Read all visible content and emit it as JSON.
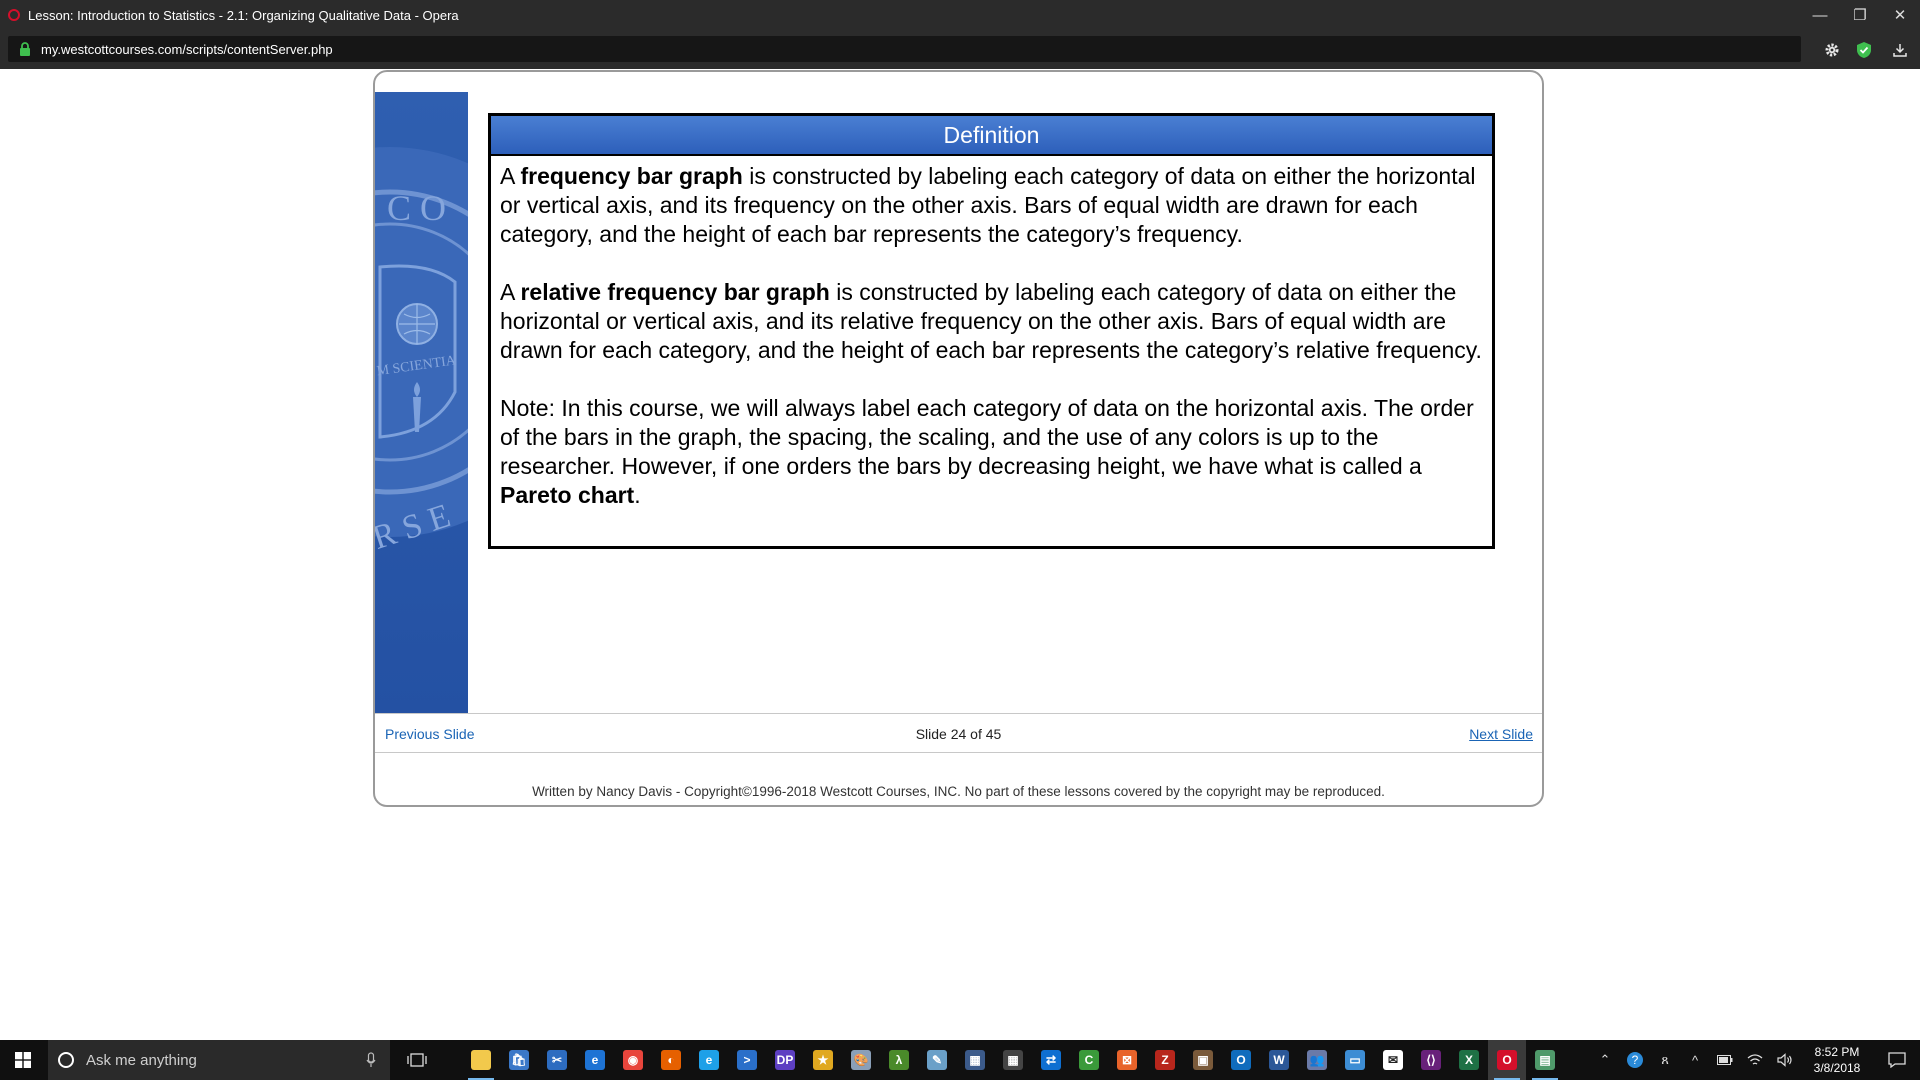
{
  "window": {
    "title": "Lesson: Introduction to Statistics - 2.1: Organizing Qualitative Data - Opera",
    "url": "my.westcottcourses.com/scripts/contentServer.php",
    "minimize_glyph": "—",
    "restore_glyph": "❐",
    "close_glyph": "✕"
  },
  "definition": {
    "header": "Definition",
    "p1_lead": "A ",
    "p1_bold": "frequency bar graph",
    "p1_rest": " is constructed by labeling each category of data on either the horizontal or vertical axis, and its frequency on the other axis.  Bars of equal width are drawn for each category, and the height of each bar represents the category’s frequency.",
    "p2_lead": "A ",
    "p2_bold": "relative frequency bar graph",
    "p2_rest": " is constructed by labeling each category of data on either the horizontal or vertical axis, and its relative frequency on the other axis.  Bars of equal width are drawn for each category, and the height of each bar represents the category’s relative frequency.",
    "p3_lead": "Note:  In this course, we will always label each category of data on the horizontal axis.  The order of the bars in the graph, the spacing, the scaling, and the use of any colors is up to the researcher.  However, if one orders the bars by decreasing height, we have what is called a ",
    "p3_bold": "Pareto chart",
    "p3_end": "."
  },
  "banner": {
    "letters_top": "C O",
    "motto": "M SCIENTIA",
    "letters_bottom": "R S E"
  },
  "navigation": {
    "previous": "Previous Slide",
    "slide_counter": "Slide 24 of 45",
    "next": "Next Slide"
  },
  "footer": {
    "copyright": "Written by Nancy Davis - Copyright©1996-2018 Westcott Courses, INC. No part of these lessons covered by the copyright may be reproduced."
  },
  "taskbar": {
    "search_placeholder": "Ask me anything",
    "apps": [
      {
        "name": "file-explorer-icon",
        "color": "#f2c94c",
        "glyph": ""
      },
      {
        "name": "store-icon",
        "color": "#3a78c8",
        "glyph": "🛍"
      },
      {
        "name": "snipping-tool-icon",
        "color": "#2d6cc0",
        "glyph": "✂"
      },
      {
        "name": "edge-icon",
        "color": "#1e73d4",
        "glyph": "e"
      },
      {
        "name": "chrome-icon",
        "color": "#e8453c",
        "glyph": "◉"
      },
      {
        "name": "firefox-icon",
        "color": "#e66000",
        "glyph": "◐"
      },
      {
        "name": "internet-explorer-icon",
        "color": "#1ea0e8",
        "glyph": "e"
      },
      {
        "name": "powershell-icon",
        "color": "#2a6fc9",
        "glyph": ">"
      },
      {
        "name": "dp-icon",
        "color": "#5d3fc2",
        "glyph": "DP"
      },
      {
        "name": "star-app-icon",
        "color": "#e0a820",
        "glyph": "★"
      },
      {
        "name": "paint-icon",
        "color": "#8a9fb8",
        "glyph": "🎨"
      },
      {
        "name": "lambda-app-icon",
        "color": "#4a8a2a",
        "glyph": "λ"
      },
      {
        "name": "notes-app-icon",
        "color": "#6aa0c8",
        "glyph": "✎"
      },
      {
        "name": "network-app-icon",
        "color": "#3b5a8a",
        "glyph": "▦"
      },
      {
        "name": "calculator-icon",
        "color": "#444444",
        "glyph": "▦"
      },
      {
        "name": "teamviewer-icon",
        "color": "#0e6fd1",
        "glyph": "⇄"
      },
      {
        "name": "camtasia-icon",
        "color": "#3a9a3a",
        "glyph": "C"
      },
      {
        "name": "orange-app-icon",
        "color": "#e8632a",
        "glyph": "⊠"
      },
      {
        "name": "filezilla-icon",
        "color": "#b8261c",
        "glyph": "Z"
      },
      {
        "name": "screen-recorder-icon",
        "color": "#7a5a3a",
        "glyph": "▣"
      },
      {
        "name": "outlook-icon",
        "color": "#0f6cbd",
        "glyph": "O"
      },
      {
        "name": "word-icon",
        "color": "#2b5797",
        "glyph": "W"
      },
      {
        "name": "users-app-icon",
        "color": "#6a7aa8",
        "glyph": "👥"
      },
      {
        "name": "remote-desktop-icon",
        "color": "#3d8dd4",
        "glyph": "▭"
      },
      {
        "name": "mail-icon",
        "color": "#ffffff",
        "glyph": "✉"
      },
      {
        "name": "visual-studio-icon",
        "color": "#68217a",
        "glyph": "⟨⟩"
      },
      {
        "name": "excel-icon",
        "color": "#1e7145",
        "glyph": "X"
      },
      {
        "name": "opera-icon",
        "color": "#d40f2b",
        "glyph": "O"
      },
      {
        "name": "control-panel-icon",
        "color": "#4f9a6a",
        "glyph": "▤"
      }
    ],
    "clock_time": "8:52 PM",
    "clock_date": "3/8/2018"
  }
}
